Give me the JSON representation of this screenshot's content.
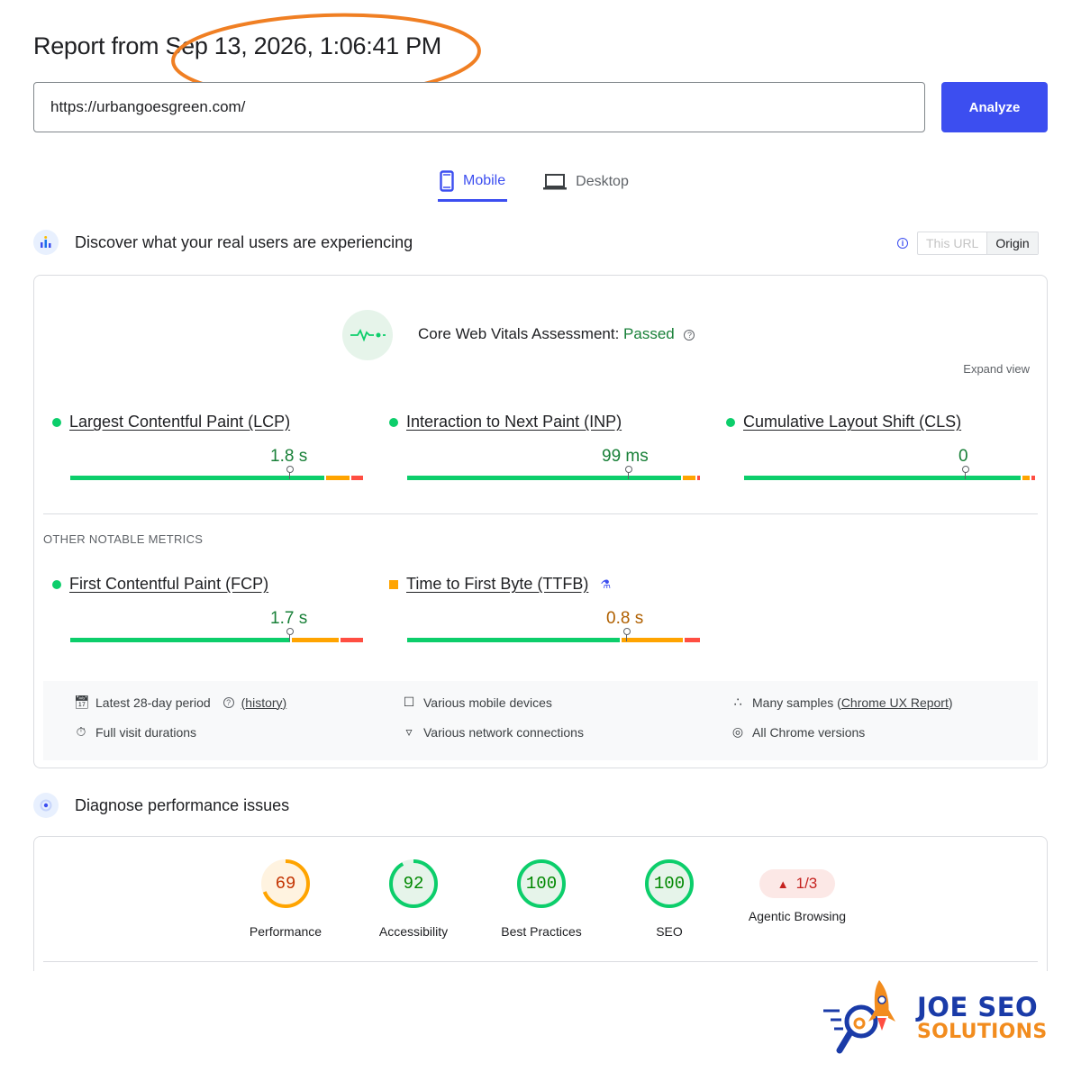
{
  "header": {
    "report_title": "Report from Sep 13, 2026, 1:06:41 PM",
    "url_value": "https://urbangoesgreen.com/",
    "analyze_label": "Analyze"
  },
  "tabs": [
    {
      "label": "Mobile",
      "icon": "mobile-icon"
    },
    {
      "label": "Desktop",
      "icon": "desktop-icon"
    }
  ],
  "field_data": {
    "heading": "Discover what your real users are experiencing",
    "toggle": {
      "this_url": "This URL",
      "origin": "Origin",
      "selected": "Origin"
    },
    "assessment": {
      "label": "Core Web Vitals Assessment:",
      "status": "Passed"
    },
    "expand_view": "Expand view",
    "other_heading": "OTHER NOTABLE METRICS",
    "core_metrics": [
      {
        "name": "Largest Contentful Paint (LCP)",
        "value": "1.8 s",
        "status": "good",
        "good_pct": 0.75
      },
      {
        "name": "Interaction to Next Paint (INP)",
        "value": "99 ms",
        "status": "good",
        "good_pct": 0.75
      },
      {
        "name": "Cumulative Layout Shift (CLS)",
        "value": "0",
        "status": "good",
        "good_pct": 0.75
      }
    ],
    "other_metrics": [
      {
        "name": "First Contentful Paint (FCP)",
        "value": "1.7 s",
        "status": "good",
        "good_pct": 0.75
      },
      {
        "name": "Time to First Byte (TTFB)",
        "value": "0.8 s",
        "status": "needs-improvement",
        "good_pct": 0.73
      }
    ],
    "footer": {
      "period": "Latest 28-day period",
      "history": "(history)",
      "durations": "Full visit durations",
      "devices": "Various mobile devices",
      "network": "Various network connections",
      "samples_prefix": "Many samples (",
      "samples_link": "Chrome UX Report",
      "samples_suffix": ")",
      "chrome": "All Chrome versions"
    }
  },
  "diagnose": {
    "heading": "Diagnose performance issues",
    "scores": [
      {
        "label": "Performance",
        "score": "69",
        "fraction": 0.69,
        "color": "#ffa400",
        "text_color": "#c33300",
        "bg": "#fff3e0"
      },
      {
        "label": "Accessibility",
        "score": "92",
        "fraction": 0.92,
        "color": "#0cce6b",
        "text_color": "#008800",
        "bg": "#e6f4ea"
      },
      {
        "label": "Best Practices",
        "score": "100",
        "fraction": 1.0,
        "color": "#0cce6b",
        "text_color": "#008800",
        "bg": "#e6f4ea"
      },
      {
        "label": "SEO",
        "score": "100",
        "fraction": 1.0,
        "color": "#0cce6b",
        "text_color": "#008800",
        "bg": "#e6f4ea"
      }
    ],
    "agentic": {
      "label": "Agentic Browsing",
      "value": "1/3"
    }
  },
  "brand": {
    "line1": "JOE SEO",
    "line2": "SOLUTIONS"
  },
  "colors": {
    "accent": "#3c4ef0",
    "good": "#0cce6b",
    "average": "#ffa400",
    "poor": "#ff4e42",
    "highlight": "#f07f23"
  }
}
